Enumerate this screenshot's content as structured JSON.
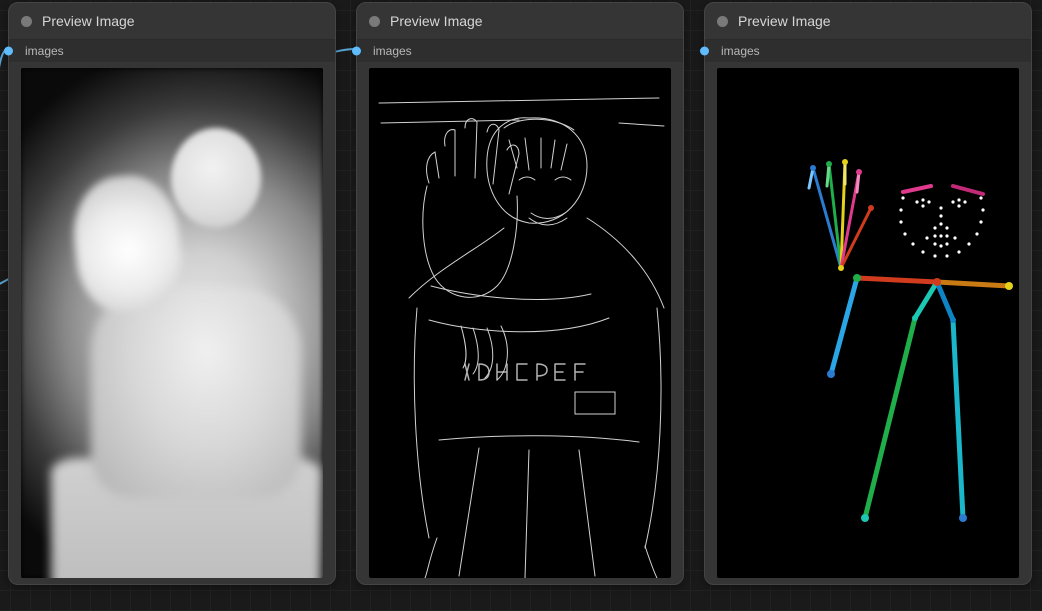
{
  "panels": [
    {
      "title": "Preview Image",
      "port_label": "images"
    },
    {
      "title": "Preview Image",
      "port_label": "images"
    },
    {
      "title": "Preview Image",
      "port_label": "images"
    }
  ]
}
